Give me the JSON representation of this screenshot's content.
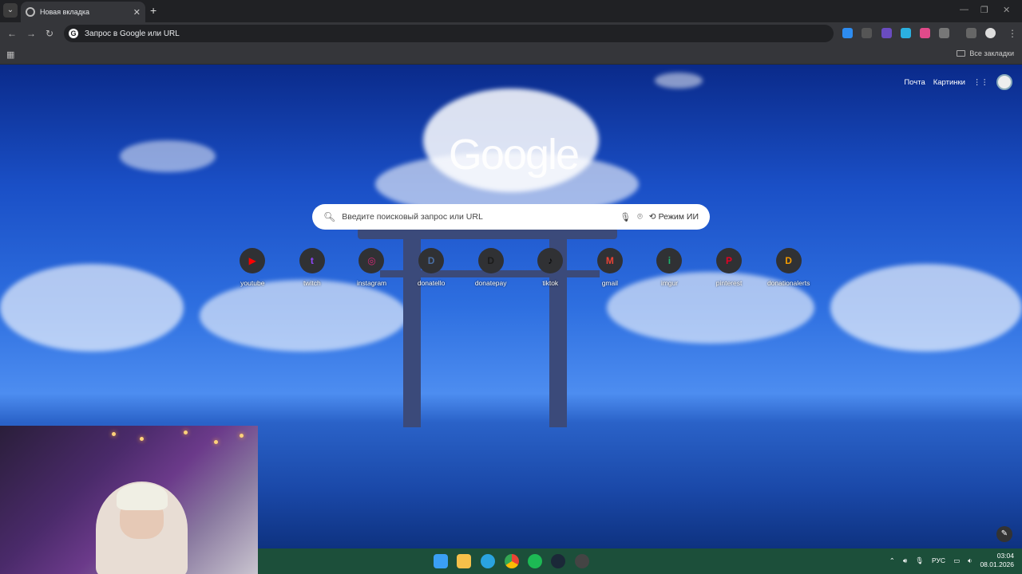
{
  "tab": {
    "title": "Новая вкладка"
  },
  "omnibox": {
    "text": "Запрос в Google или URL"
  },
  "bookmarks": {
    "all_label": "Все закладки"
  },
  "header": {
    "mail": "Почта",
    "images": "Картинки"
  },
  "logo": {
    "text": "Google"
  },
  "search": {
    "placeholder": "Введите поисковый запрос или URL",
    "ai_mode": "Режим ИИ"
  },
  "shortcuts": [
    {
      "label": "youtube",
      "glyph": "▶",
      "color": "#ff0000"
    },
    {
      "label": "twitch",
      "glyph": "t",
      "color": "#9146ff"
    },
    {
      "label": "instagram",
      "glyph": "◎",
      "color": "#d62976"
    },
    {
      "label": "donatello",
      "glyph": "D",
      "color": "#4a6fa5"
    },
    {
      "label": "donatepay",
      "glyph": "D",
      "color": "#1b1b1b"
    },
    {
      "label": "tiktok",
      "glyph": "♪",
      "color": "#000000"
    },
    {
      "label": "gmail",
      "glyph": "M",
      "color": "#ea4335"
    },
    {
      "label": "imgur",
      "glyph": "i",
      "color": "#1bb76e"
    },
    {
      "label": "pinterest",
      "glyph": "P",
      "color": "#e60023"
    },
    {
      "label": "donationalerts",
      "glyph": "D",
      "color": "#f59c00"
    }
  ],
  "tray": {
    "lang": "РУС",
    "time": "03:04",
    "date": "08.01.2026"
  }
}
